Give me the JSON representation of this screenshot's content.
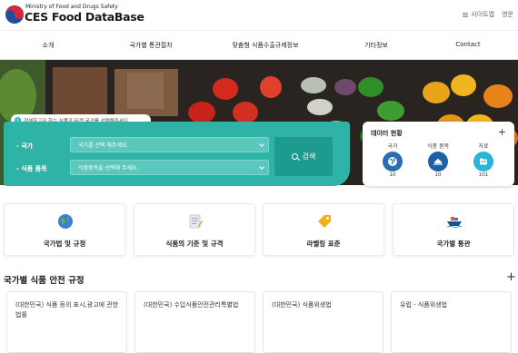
{
  "header": {
    "brand_small": "Ministry of Food and Drugs Safety",
    "brand_title": "CES Food DataBase",
    "sitemap_label": "사이트맵",
    "language_label": "영문",
    "logo_icon": "mfds-taegeuk-logo"
  },
  "nav": {
    "items": [
      {
        "label": "소개"
      },
      {
        "label": "국가별 통관절차"
      },
      {
        "label": "맞춤형 식품수출규제정보"
      },
      {
        "label": "기타정보"
      },
      {
        "label": "Contact"
      }
    ]
  },
  "hero": {
    "image": "vegetable-market-photo"
  },
  "search": {
    "notice": "검색하고자 하는 식품과 타겟 국가를 선택해주세요.",
    "country_label": "- 국가",
    "country_placeholder": "국가를 선택 해주세요.",
    "item_label": "- 식품 품목",
    "item_placeholder": "식품품목을 선택해 주세요.",
    "button_label": "검색",
    "accent_color": "#2fb3a6",
    "button_color": "#1d9b8f"
  },
  "status": {
    "title": "데이터 현황",
    "stats": [
      {
        "label": "국가",
        "value": "10",
        "icon": "globe-icon",
        "color": "#2a6db0"
      },
      {
        "label": "식품 품목",
        "value": "10",
        "icon": "cloche-icon",
        "color": "#1e5fa8"
      },
      {
        "label": "자료",
        "value": "101",
        "icon": "folder-icon",
        "color": "#2bb3d8"
      }
    ]
  },
  "cards": [
    {
      "label": "국가법 및 규정",
      "icon": "globe-icon"
    },
    {
      "label": "식품의 기준 및 규격",
      "icon": "document-pen-icon"
    },
    {
      "label": "라벨링 표준",
      "icon": "label-tag-icon"
    },
    {
      "label": "국가별 통관",
      "icon": "cargo-ship-icon"
    }
  ],
  "regulations": {
    "title": "국가별 식품 안전 규정",
    "items": [
      {
        "text": "(대한민국) 식품 등의 표시,광고에 관한 법률"
      },
      {
        "text": "(대한민국) 수입식품안전관리특별법"
      },
      {
        "text": "(대한민국) 식품위생법"
      },
      {
        "text": "유럽 - 식품위생법"
      }
    ]
  }
}
